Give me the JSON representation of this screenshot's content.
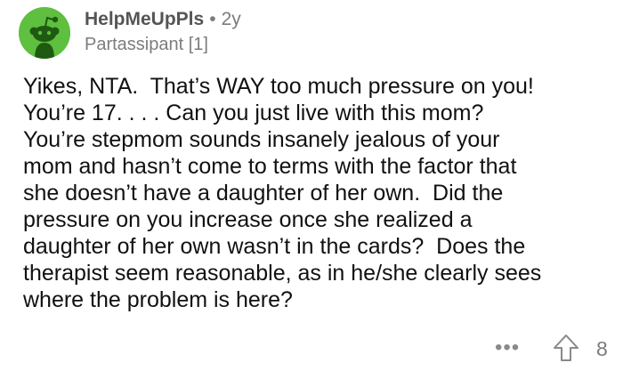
{
  "comment": {
    "author": "HelpMeUpPls",
    "separator": "•",
    "age": "2y",
    "flair": "Partassipant [1]",
    "body": "Yikes, NTA.  That’s WAY too much pressure on you!\nYou’re 17. . . . Can you just live with this mom?\nYou’re stepmom sounds insanely jealous of your\nmom and hasn’t come to terms with the factor that\nshe doesn’t have a daughter of her own.  Did the\npressure on you increase once she realized a\ndaughter of her own wasn’t in the cards?  Does the\ntherapist seem reasonable, as in he/she clearly sees\nwhere the problem is here?",
    "more_label": "•••",
    "score": "8"
  },
  "icons": {
    "avatar": "reddit-snoo-avatar",
    "more": "more-options-icon",
    "upvote": "upvote-arrow-icon"
  },
  "colors": {
    "avatar_bg": "#5fbf3f",
    "text": "#111111",
    "meta": "#7c7c7c"
  }
}
